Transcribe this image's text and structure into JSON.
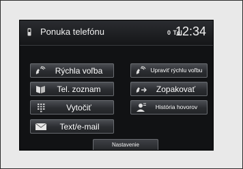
{
  "header": {
    "title": "Ponuka telefónu",
    "status": "0 Tel",
    "clock": "12:34"
  },
  "buttons": {
    "speed_dial": "Rýchla voľba",
    "edit_speed_dial": "Upraviť rýchlu voľbu",
    "phonebook": "Tel. zoznam",
    "redial": "Zopakovať",
    "dial": "Vytočiť",
    "call_history": "História hovorov",
    "text_email": "Text/e-mail"
  },
  "footer": {
    "settings": "Nastavenie"
  },
  "icons": {
    "phone": "mobile-phone-icon",
    "speed_dial": "handset-speed-icon",
    "phonebook": "phonebook-icon",
    "redial": "redial-icon",
    "dial": "keypad-icon",
    "call_history": "call-history-icon",
    "text_email": "envelope-icon"
  }
}
